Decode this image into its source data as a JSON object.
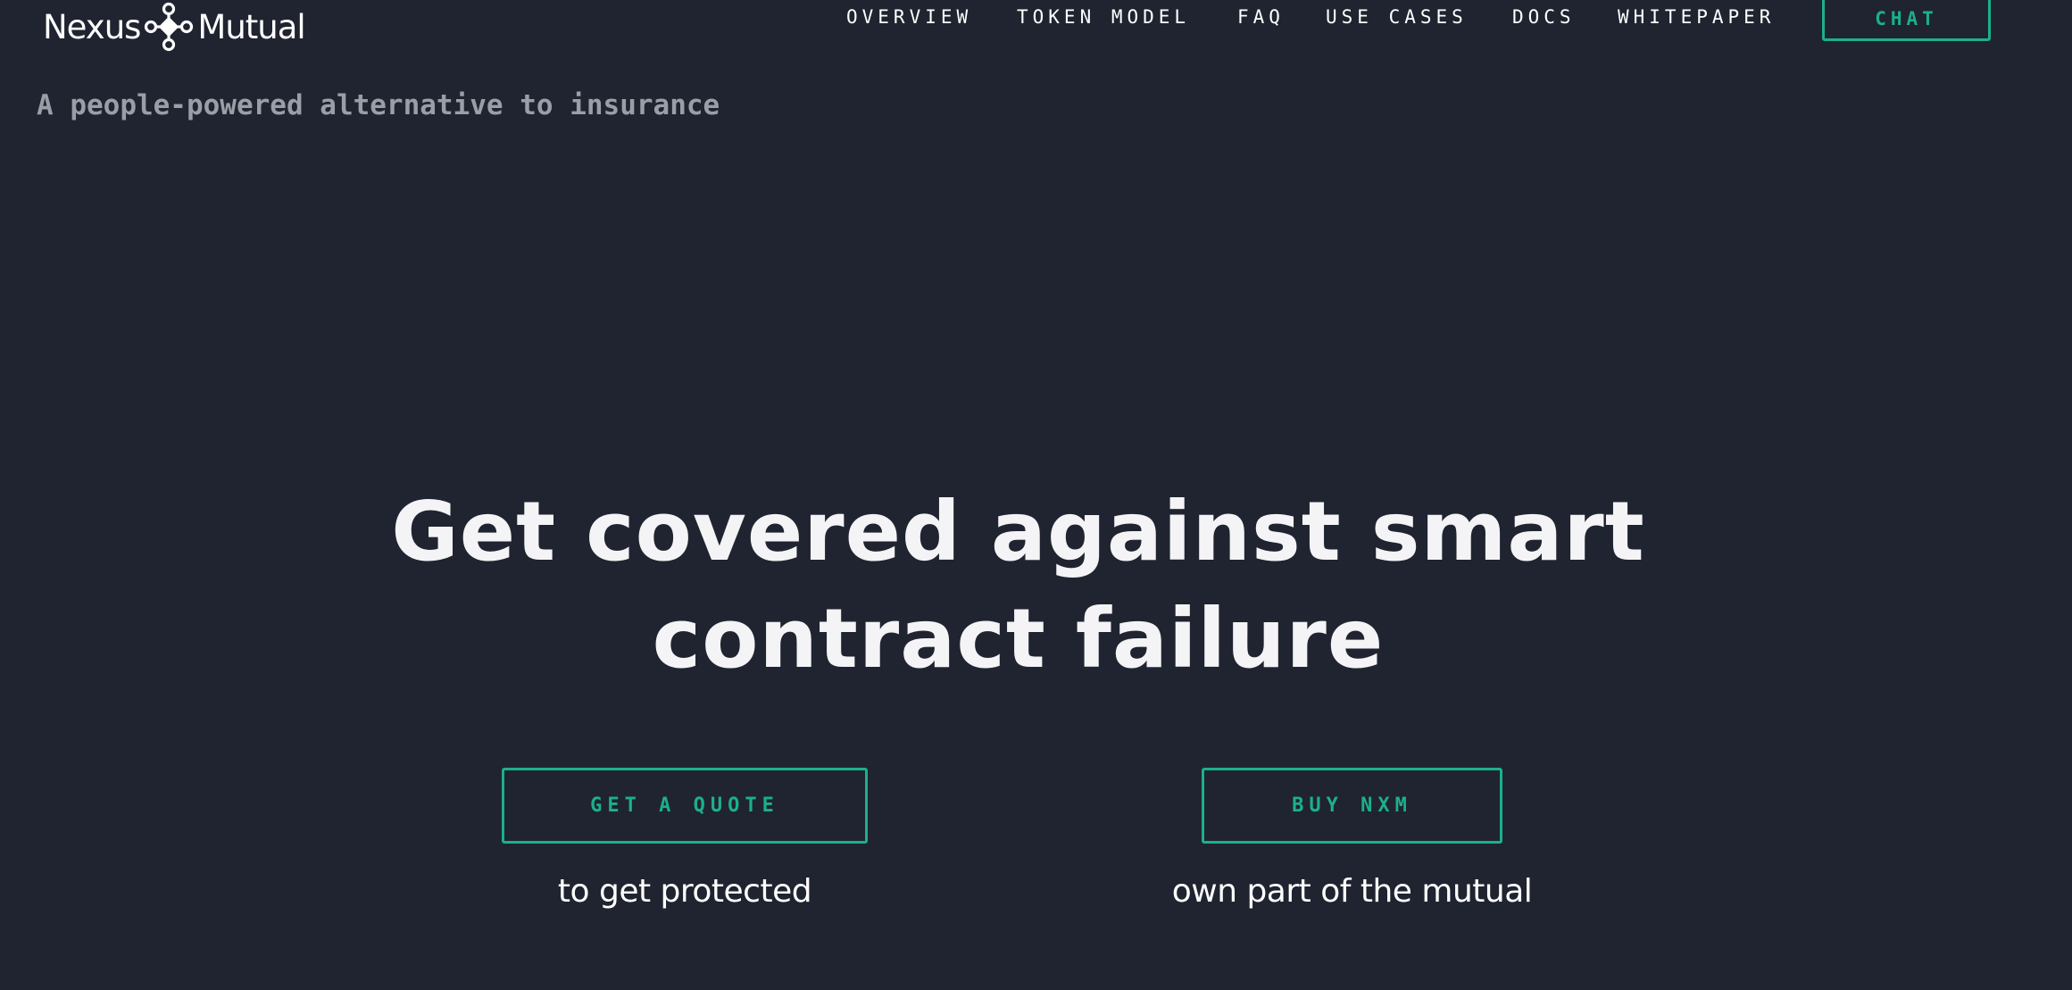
{
  "header": {
    "logo": {
      "text_left": "Nexus",
      "text_right": "Mutual",
      "icon": "nexus-mutual-logo-icon"
    },
    "nav": [
      {
        "label": "OVERVIEW"
      },
      {
        "label": "TOKEN MODEL"
      },
      {
        "label": "FAQ"
      },
      {
        "label": "USE CASES"
      },
      {
        "label": "DOCS"
      },
      {
        "label": "WHITEPAPER"
      }
    ],
    "chat_label": "CHAT"
  },
  "tagline": "A people-powered alternative to insurance",
  "hero": {
    "title_line1": "Get covered against smart",
    "title_line2": "contract failure",
    "ctas": [
      {
        "label": "GET A QUOTE",
        "caption": "to get protected"
      },
      {
        "label": "BUY NXM",
        "caption": "own part of the mutual"
      }
    ]
  },
  "colors": {
    "background": "#1f2430",
    "accent": "#1cb08a",
    "text": "#f4f4f6",
    "muted": "#9a9ea6"
  }
}
